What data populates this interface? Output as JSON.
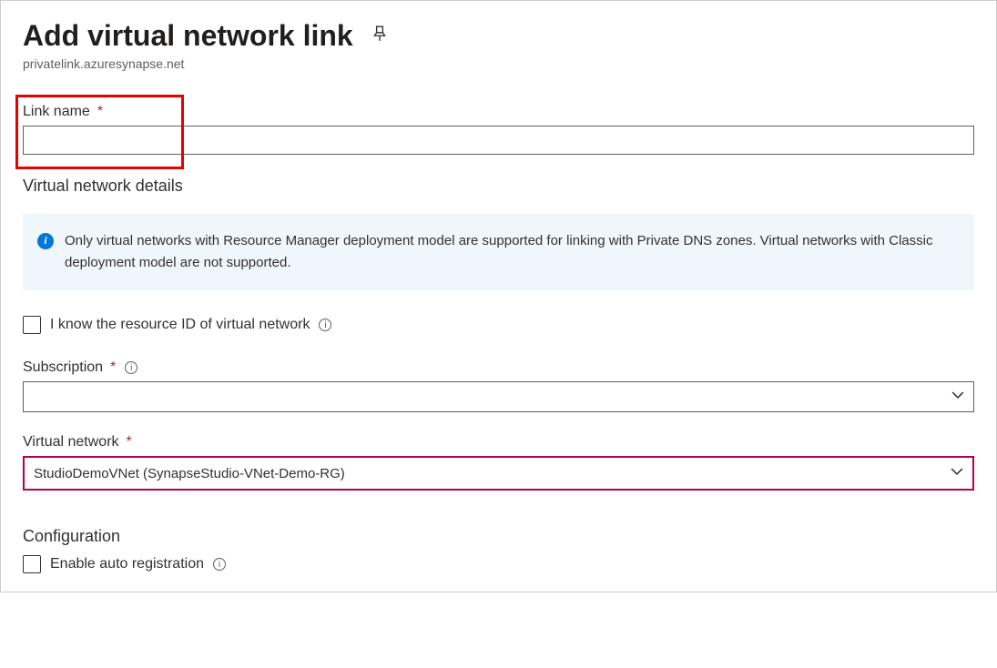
{
  "header": {
    "title": "Add virtual network link",
    "subtitle": "privatelink.azuresynapse.net"
  },
  "linkName": {
    "label": "Link name",
    "value": ""
  },
  "vnetDetails": {
    "heading": "Virtual network details",
    "infoText": "Only virtual networks with Resource Manager deployment model are supported for linking with Private DNS zones. Virtual networks with Classic deployment model are not supported."
  },
  "knowResourceId": {
    "label": "I know the resource ID of virtual network"
  },
  "subscription": {
    "label": "Subscription",
    "value": ""
  },
  "virtualNetwork": {
    "label": "Virtual network",
    "value": "StudioDemoVNet (SynapseStudio-VNet-Demo-RG)"
  },
  "configuration": {
    "heading": "Configuration",
    "autoRegLabel": "Enable auto registration"
  }
}
